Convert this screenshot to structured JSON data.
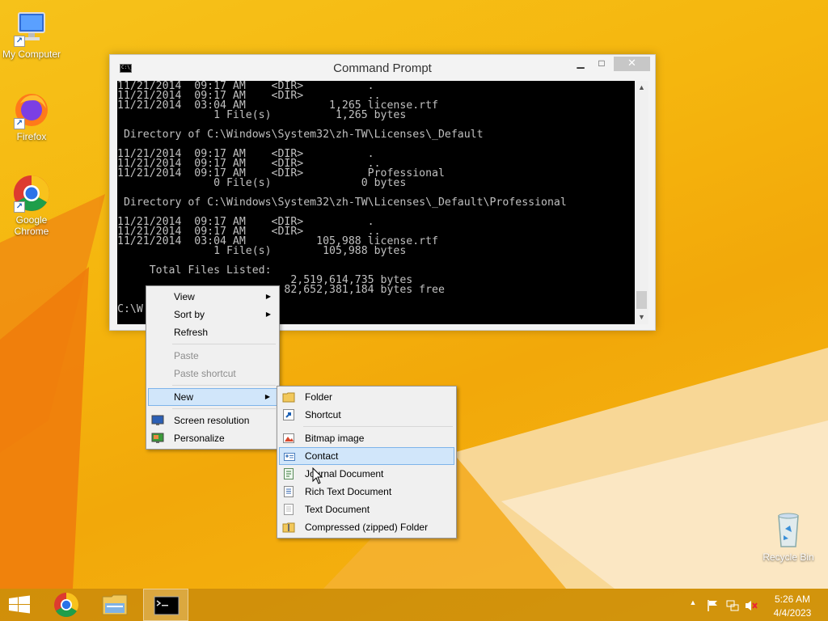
{
  "desktop": {
    "icons": [
      {
        "label": "My Computer"
      },
      {
        "label": "Firefox"
      },
      {
        "label": "Google Chrome"
      },
      {
        "label": "Recycle Bin"
      }
    ]
  },
  "cmd": {
    "title": "Command Prompt",
    "buttons": {
      "minimize": "▁",
      "maximize": "□",
      "close": "✕"
    },
    "icon_text": "C:\\_",
    "lines": [
      "11/21/2014  09:17 AM    <DIR>          .",
      "11/21/2014  09:17 AM    <DIR>          ..",
      "11/21/2014  03:04 AM             1,265 license.rtf",
      "               1 File(s)          1,265 bytes",
      "",
      " Directory of C:\\Windows\\System32\\zh-TW\\Licenses\\_Default",
      "",
      "11/21/2014  09:17 AM    <DIR>          .",
      "11/21/2014  09:17 AM    <DIR>          ..",
      "11/21/2014  09:17 AM    <DIR>          Professional",
      "               0 File(s)              0 bytes",
      "",
      " Directory of C:\\Windows\\System32\\zh-TW\\Licenses\\_Default\\Professional",
      "",
      "11/21/2014  09:17 AM    <DIR>          .",
      "11/21/2014  09:17 AM    <DIR>          ..",
      "11/21/2014  03:04 AM           105,988 license.rtf",
      "               1 File(s)        105,988 bytes",
      "",
      "     Total Files Listed:",
      "                           2,519,614,735 bytes",
      "                          82,652,381,184 bytes free",
      "",
      "C:\\W"
    ]
  },
  "context_menu": {
    "view": "View",
    "sort_by": "Sort by",
    "refresh": "Refresh",
    "paste": "Paste",
    "paste_shortcut": "Paste shortcut",
    "new": "New",
    "screen_resolution": "Screen resolution",
    "personalize": "Personalize"
  },
  "new_submenu": {
    "folder": "Folder",
    "shortcut": "Shortcut",
    "bitmap": "Bitmap image",
    "contact": "Contact",
    "journal": "Journal Document",
    "rtf": "Rich Text Document",
    "text": "Text Document",
    "zip": "Compressed (zipped) Folder"
  },
  "taskbar": {
    "clock_time": "5:26 AM",
    "clock_date": "4/4/2023"
  },
  "colors": {
    "wallpaper": "#f5b60e",
    "menu_highlight": "#d1e6fa",
    "close_button": "#c7c7c7"
  }
}
